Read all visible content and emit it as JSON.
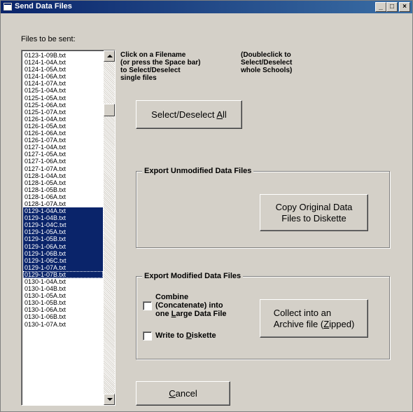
{
  "window": {
    "title": "Send Data Files",
    "controls": [
      "_",
      "□",
      "×"
    ]
  },
  "files_label": "Files to be sent:",
  "hint_single": [
    "Click on a Filename",
    "(or press the Space bar)",
    "to Select/Deselect",
    "single files"
  ],
  "hint_double": [
    "(Doubleclick to",
    "Select/Deselect",
    "whole Schools)"
  ],
  "files": [
    {
      "name": "0123-1-09B.txt",
      "selected": false
    },
    {
      "name": "0124-1-04A.txt",
      "selected": false
    },
    {
      "name": "0124-1-05A.txt",
      "selected": false
    },
    {
      "name": "0124-1-06A.txt",
      "selected": false
    },
    {
      "name": "0124-1-07A.txt",
      "selected": false
    },
    {
      "name": "0125-1-04A.txt",
      "selected": false
    },
    {
      "name": "0125-1-05A.txt",
      "selected": false
    },
    {
      "name": "0125-1-06A.txt",
      "selected": false
    },
    {
      "name": "0125-1-07A.txt",
      "selected": false
    },
    {
      "name": "0126-1-04A.txt",
      "selected": false
    },
    {
      "name": "0126-1-05A.txt",
      "selected": false
    },
    {
      "name": "0126-1-06A.txt",
      "selected": false
    },
    {
      "name": "0126-1-07A.txt",
      "selected": false
    },
    {
      "name": "0127-1-04A.txt",
      "selected": false
    },
    {
      "name": "0127-1-05A.txt",
      "selected": false
    },
    {
      "name": "0127-1-06A.txt",
      "selected": false
    },
    {
      "name": "0127-1-07A.txt",
      "selected": false
    },
    {
      "name": "0128-1-04A.txt",
      "selected": false
    },
    {
      "name": "0128-1-05A.txt",
      "selected": false
    },
    {
      "name": "0128-1-05B.txt",
      "selected": false
    },
    {
      "name": "0128-1-06A.txt",
      "selected": false
    },
    {
      "name": "0128-1-07A.txt",
      "selected": false
    },
    {
      "name": "0129-1-04A.txt",
      "selected": true
    },
    {
      "name": "0129-1-04B.txt",
      "selected": true
    },
    {
      "name": "0129-1-04C.txt",
      "selected": true
    },
    {
      "name": "0129-1-05A.txt",
      "selected": true
    },
    {
      "name": "0129-1-05B.txt",
      "selected": true
    },
    {
      "name": "0129-1-06A.txt",
      "selected": true
    },
    {
      "name": "0129-1-06B.txt",
      "selected": true
    },
    {
      "name": "0129-1-06C.txt",
      "selected": true
    },
    {
      "name": "0129-1-07A.txt",
      "selected": true
    },
    {
      "name": "0129-1-07B.txt",
      "selected": true,
      "focused": true
    },
    {
      "name": "0130-1-04A.txt",
      "selected": false
    },
    {
      "name": "0130-1-04B.txt",
      "selected": false
    },
    {
      "name": "0130-1-05A.txt",
      "selected": false
    },
    {
      "name": "0130-1-05B.txt",
      "selected": false
    },
    {
      "name": "0130-1-06A.txt",
      "selected": false
    },
    {
      "name": "0130-1-06B.txt",
      "selected": false
    },
    {
      "name": "0130-1-07A.txt",
      "selected": false
    }
  ],
  "buttons": {
    "select_all": {
      "pre": "Select/Deselect ",
      "key": "A",
      "post": "ll"
    },
    "copy_original": "Copy Original Data Files to Diskette",
    "collect_archive": {
      "line1": "Collect into an",
      "pre": "Archive file (",
      "key": "Z",
      "post": "ipped)"
    },
    "cancel": {
      "pre": "",
      "key": "C",
      "post": "ancel"
    }
  },
  "groups": {
    "unmodified": "Export Unmodified Data Files",
    "modified": "Export Modified Data Files"
  },
  "checkboxes": {
    "combine": {
      "lines": [
        "Combine",
        "(Concatenate) into"
      ],
      "line3_pre": "one ",
      "line3_key": "L",
      "line3_post": "arge Data File",
      "checked": false
    },
    "write_diskette": {
      "pre": "Write to ",
      "key": "D",
      "post": "iskette",
      "checked": false
    }
  },
  "colors": {
    "titlebar": "#0a246a",
    "selection": "#0a246a",
    "face": "#d4d0c8"
  }
}
